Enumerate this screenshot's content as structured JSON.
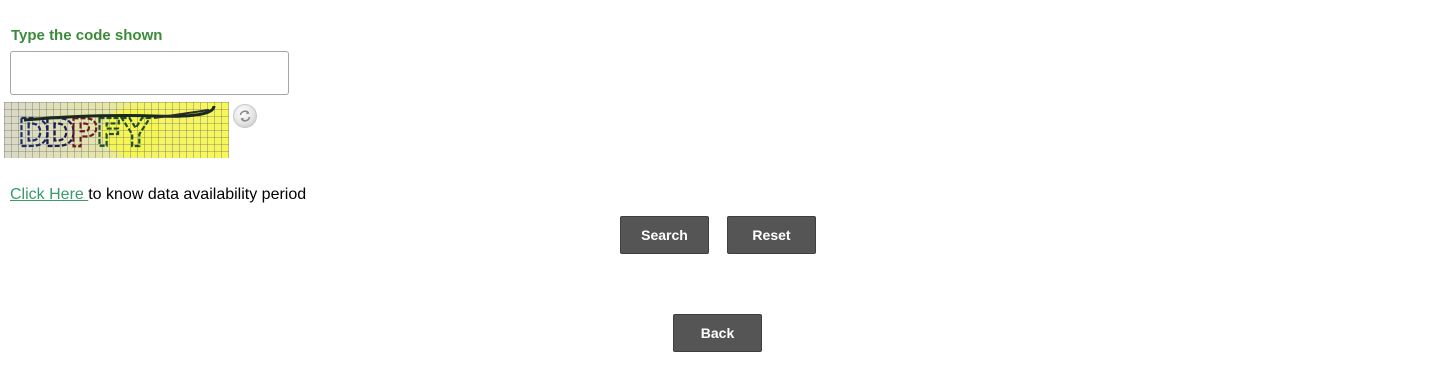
{
  "captcha": {
    "label": "Type the code shown",
    "input_value": "",
    "input_placeholder": "",
    "image_text": "DDPFY",
    "refresh_icon": "refresh-icon"
  },
  "availability": {
    "link_text": "Click Here ",
    "suffix_text": "to know data availability period"
  },
  "actions": {
    "search_label": "Search",
    "reset_label": "Reset",
    "back_label": "Back"
  },
  "colors": {
    "label_green": "#3a8c3a",
    "link_green": "#3a9a6a",
    "button_bg": "#555555",
    "button_text": "#ffffff",
    "captcha_yellow": "#f2f25a"
  }
}
